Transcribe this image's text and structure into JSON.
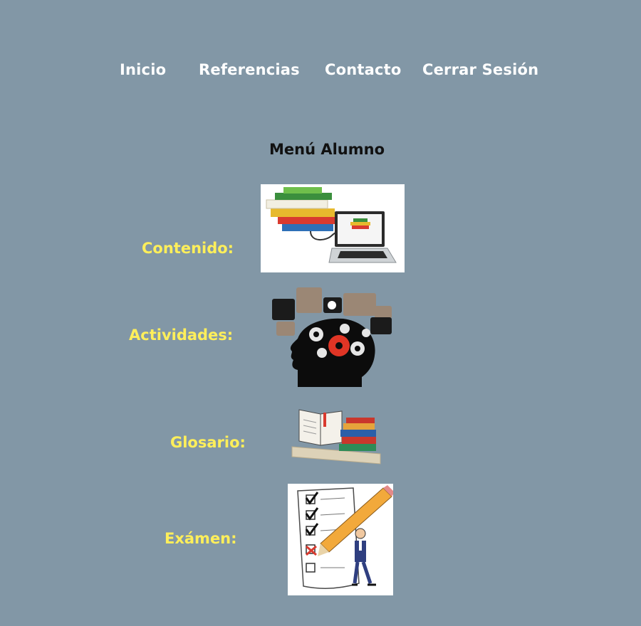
{
  "nav": {
    "items": [
      {
        "label": "Inicio"
      },
      {
        "label": "Referencias"
      },
      {
        "label": "Contacto"
      },
      {
        "label": "Cerrar  Sesión"
      }
    ]
  },
  "page_title": "Menú Alumno",
  "menu": {
    "items": [
      {
        "label": "Contenido:",
        "icon": "books-laptop-icon"
      },
      {
        "label": "Actividades:",
        "icon": "head-gears-icon"
      },
      {
        "label": "Glosario:",
        "icon": "book-shelf-icon"
      },
      {
        "label": "Exámen:",
        "icon": "checklist-pencil-icon"
      }
    ]
  },
  "colors": {
    "background": "#8297a6",
    "nav_text": "#ffffff",
    "title_text": "#111111",
    "label_text": "#ffef5a"
  }
}
